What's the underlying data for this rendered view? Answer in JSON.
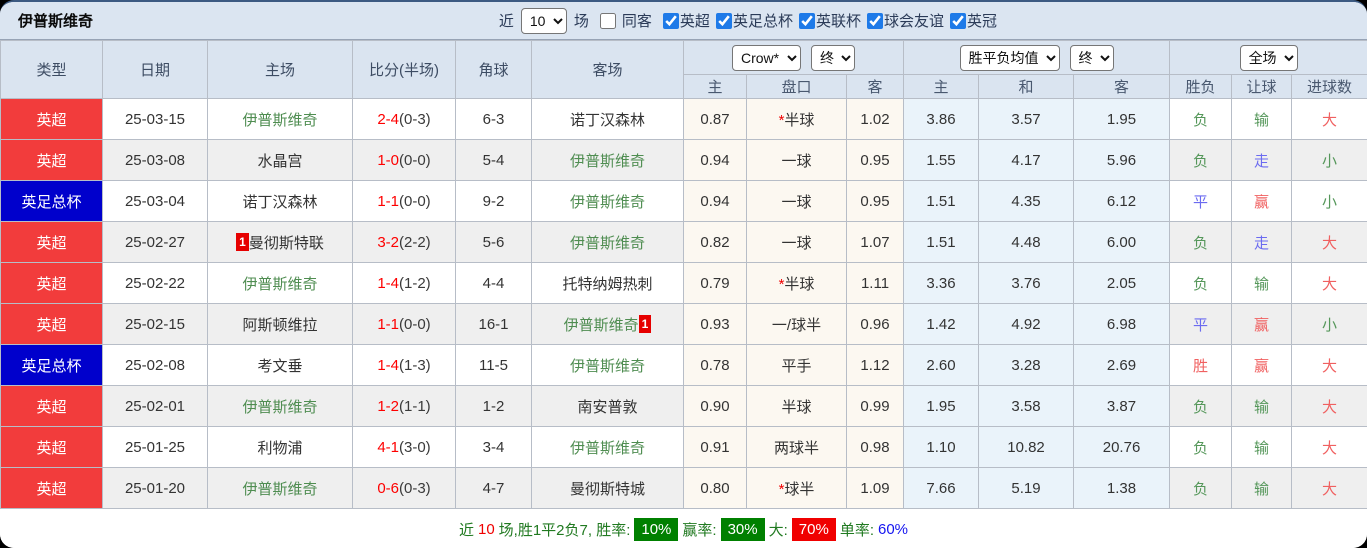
{
  "header": {
    "team_title": "伊普斯维奇",
    "recent_label": "近",
    "recent_value": "10",
    "matches_label": "场",
    "same_venue_label": "同客",
    "filters": [
      {
        "label": "英超",
        "checked": true
      },
      {
        "label": "英足总杯",
        "checked": true
      },
      {
        "label": "英联杯",
        "checked": true
      },
      {
        "label": "球会友谊",
        "checked": true
      },
      {
        "label": "英冠",
        "checked": true
      }
    ]
  },
  "table": {
    "left_headers": [
      "类型",
      "日期",
      "主场",
      "比分(半场)",
      "角球",
      "客场"
    ],
    "groups": {
      "asia": {
        "select_label": "Crow*",
        "period_label": "终"
      },
      "europe": {
        "select_label": "胜平负均值",
        "period_label": "终"
      },
      "result": {
        "select_label": "全场"
      }
    },
    "sub_headers": [
      "主",
      "盘口",
      "客",
      "主",
      "和",
      "客",
      "胜负",
      "让球",
      "进球数"
    ],
    "rows": [
      {
        "type": "英超",
        "type_color": "red",
        "date": "25-03-15",
        "home": {
          "name": "伊普斯维奇",
          "self": true
        },
        "score": "2-4",
        "half": "(0-3)",
        "corners": "6-3",
        "away": {
          "name": "诺丁汉森林",
          "self": false
        },
        "asia": {
          "home": "0.87",
          "star": true,
          "line": "半球",
          "away": "1.02"
        },
        "europe": {
          "win": "3.86",
          "draw": "3.57",
          "lose": "1.95"
        },
        "outcome": {
          "text": "负",
          "color": "green"
        },
        "handicap_res": {
          "text": "输",
          "color": "green"
        },
        "goals": {
          "text": "大",
          "color": "red"
        }
      },
      {
        "type": "英超",
        "type_color": "red",
        "date": "25-03-08",
        "home": {
          "name": "水晶宫",
          "self": false
        },
        "score": "1-0",
        "half": "(0-0)",
        "corners": "5-4",
        "away": {
          "name": "伊普斯维奇",
          "self": true
        },
        "asia": {
          "home": "0.94",
          "star": false,
          "line": "一球",
          "away": "0.95"
        },
        "europe": {
          "win": "1.55",
          "draw": "4.17",
          "lose": "5.96"
        },
        "outcome": {
          "text": "负",
          "color": "green"
        },
        "handicap_res": {
          "text": "走",
          "color": "blue"
        },
        "goals": {
          "text": "小",
          "color": "green"
        }
      },
      {
        "type": "英足总杯",
        "type_color": "blue",
        "date": "25-03-04",
        "home": {
          "name": "诺丁汉森林",
          "self": false
        },
        "score": "1-1",
        "half": "(0-0)",
        "corners": "9-2",
        "away": {
          "name": "伊普斯维奇",
          "self": true
        },
        "asia": {
          "home": "0.94",
          "star": false,
          "line": "一球",
          "away": "0.95"
        },
        "europe": {
          "win": "1.51",
          "draw": "4.35",
          "lose": "6.12"
        },
        "outcome": {
          "text": "平",
          "color": "blue"
        },
        "handicap_res": {
          "text": "赢",
          "color": "red"
        },
        "goals": {
          "text": "小",
          "color": "green"
        }
      },
      {
        "type": "英超",
        "type_color": "red",
        "date": "25-02-27",
        "home": {
          "name": "曼彻斯特联",
          "self": false,
          "card": "before"
        },
        "score": "3-2",
        "half": "(2-2)",
        "corners": "5-6",
        "away": {
          "name": "伊普斯维奇",
          "self": true
        },
        "asia": {
          "home": "0.82",
          "star": false,
          "line": "一球",
          "away": "1.07"
        },
        "europe": {
          "win": "1.51",
          "draw": "4.48",
          "lose": "6.00"
        },
        "outcome": {
          "text": "负",
          "color": "green"
        },
        "handicap_res": {
          "text": "走",
          "color": "blue"
        },
        "goals": {
          "text": "大",
          "color": "red"
        }
      },
      {
        "type": "英超",
        "type_color": "red",
        "date": "25-02-22",
        "home": {
          "name": "伊普斯维奇",
          "self": true
        },
        "score": "1-4",
        "half": "(1-2)",
        "corners": "4-4",
        "away": {
          "name": "托特纳姆热刺",
          "self": false
        },
        "asia": {
          "home": "0.79",
          "star": true,
          "line": "半球",
          "away": "1.11"
        },
        "europe": {
          "win": "3.36",
          "draw": "3.76",
          "lose": "2.05"
        },
        "outcome": {
          "text": "负",
          "color": "green"
        },
        "handicap_res": {
          "text": "输",
          "color": "green"
        },
        "goals": {
          "text": "大",
          "color": "red"
        }
      },
      {
        "type": "英超",
        "type_color": "red",
        "date": "25-02-15",
        "home": {
          "name": "阿斯顿维拉",
          "self": false
        },
        "score": "1-1",
        "half": "(0-0)",
        "corners": "16-1",
        "away": {
          "name": "伊普斯维奇",
          "self": true,
          "card": "after"
        },
        "asia": {
          "home": "0.93",
          "star": false,
          "line": "一/球半",
          "away": "0.96"
        },
        "europe": {
          "win": "1.42",
          "draw": "4.92",
          "lose": "6.98"
        },
        "outcome": {
          "text": "平",
          "color": "blue"
        },
        "handicap_res": {
          "text": "赢",
          "color": "red"
        },
        "goals": {
          "text": "小",
          "color": "green"
        }
      },
      {
        "type": "英足总杯",
        "type_color": "blue",
        "date": "25-02-08",
        "home": {
          "name": "考文垂",
          "self": false
        },
        "score": "1-4",
        "half": "(1-3)",
        "corners": "11-5",
        "away": {
          "name": "伊普斯维奇",
          "self": true
        },
        "asia": {
          "home": "0.78",
          "star": false,
          "line": "平手",
          "away": "1.12"
        },
        "europe": {
          "win": "2.60",
          "draw": "3.28",
          "lose": "2.69"
        },
        "outcome": {
          "text": "胜",
          "color": "red"
        },
        "handicap_res": {
          "text": "赢",
          "color": "red"
        },
        "goals": {
          "text": "大",
          "color": "red"
        }
      },
      {
        "type": "英超",
        "type_color": "red",
        "date": "25-02-01",
        "home": {
          "name": "伊普斯维奇",
          "self": true
        },
        "score": "1-2",
        "half": "(1-1)",
        "corners": "1-2",
        "away": {
          "name": "南安普敦",
          "self": false
        },
        "asia": {
          "home": "0.90",
          "star": false,
          "line": "半球",
          "away": "0.99"
        },
        "europe": {
          "win": "1.95",
          "draw": "3.58",
          "lose": "3.87"
        },
        "outcome": {
          "text": "负",
          "color": "green"
        },
        "handicap_res": {
          "text": "输",
          "color": "green"
        },
        "goals": {
          "text": "大",
          "color": "red"
        }
      },
      {
        "type": "英超",
        "type_color": "red",
        "date": "25-01-25",
        "home": {
          "name": "利物浦",
          "self": false
        },
        "score": "4-1",
        "half": "(3-0)",
        "corners": "3-4",
        "away": {
          "name": "伊普斯维奇",
          "self": true
        },
        "asia": {
          "home": "0.91",
          "star": false,
          "line": "两球半",
          "away": "0.98"
        },
        "europe": {
          "win": "1.10",
          "draw": "10.82",
          "lose": "20.76"
        },
        "outcome": {
          "text": "负",
          "color": "green"
        },
        "handicap_res": {
          "text": "输",
          "color": "green"
        },
        "goals": {
          "text": "大",
          "color": "red"
        }
      },
      {
        "type": "英超",
        "type_color": "red",
        "date": "25-01-20",
        "home": {
          "name": "伊普斯维奇",
          "self": true
        },
        "score": "0-6",
        "half": "(0-3)",
        "corners": "4-7",
        "away": {
          "name": "曼彻斯特城",
          "self": false
        },
        "asia": {
          "home": "0.80",
          "star": true,
          "line": "球半",
          "away": "1.09"
        },
        "europe": {
          "win": "7.66",
          "draw": "5.19",
          "lose": "1.38"
        },
        "outcome": {
          "text": "负",
          "color": "green"
        },
        "handicap_res": {
          "text": "输",
          "color": "green"
        },
        "goals": {
          "text": "大",
          "color": "red"
        }
      }
    ]
  },
  "footer": {
    "prefix": "近",
    "count": "10",
    "summary": "场,胜1平2负7, 胜率:",
    "win_rate": "10%",
    "label_win_handicap": "赢率:",
    "win_handicap_rate": "30%",
    "label_big": "大:",
    "big_rate": "70%",
    "label_single": "单率:",
    "single_rate": "60%"
  }
}
